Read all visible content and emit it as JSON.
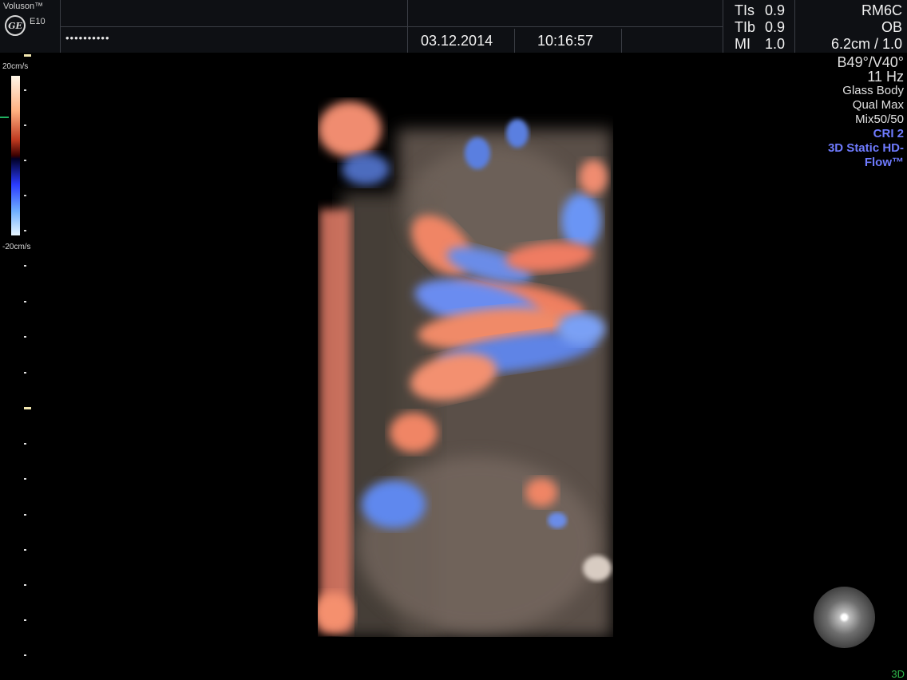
{
  "header": {
    "brand": "Voluson™",
    "logo": "GE",
    "model": "E10",
    "patient_masked": "••••••••••",
    "date": "03.12.2014",
    "time": "10:16:57",
    "tis_label": "TIs",
    "tis_value": "0.9",
    "tib_label": "TIb",
    "tib_value": "0.9",
    "mi_label": "MI",
    "mi_value": "1.0",
    "probe": "RM6C",
    "application": "OB",
    "depth_zoom": "6.2cm / 1.0"
  },
  "params": {
    "angles": "B49°/V40°",
    "frame_rate": "11 Hz",
    "render_mode": "Glass Body",
    "quality": "Qual Max",
    "mix": "Mix50/50",
    "cri": "CRI 2",
    "mode_line1": "3D Static HD-",
    "mode_line2": "Flow™"
  },
  "color_scale": {
    "top_label": "20cm/s",
    "bottom_label": "-20cm/s"
  },
  "footer": {
    "mode_tag": "3D"
  },
  "colors": {
    "accent_blue": "#6f7bff",
    "mode_green": "#2fb84a",
    "baseline_green": "#20b060"
  },
  "icons": {
    "logo": "ge-logo",
    "orientation": "orientation-sphere-icon"
  }
}
